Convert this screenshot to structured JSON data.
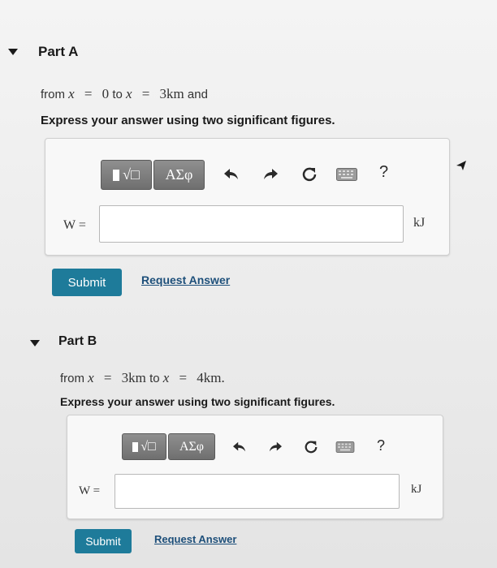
{
  "partA": {
    "title": "Part A",
    "line": {
      "from": "from",
      "x1": "x",
      "eq1": "=",
      "v1": "0",
      "to": "to",
      "x2": "x",
      "eq2": "=",
      "v2": "3km",
      "tail": "and"
    },
    "instruction": "Express your answer using two significant figures.",
    "toolbar": {
      "templates_label": "√□",
      "greek_label": "ΑΣφ",
      "help_label": "?"
    },
    "input_label": "W =",
    "input_value": "",
    "unit": "kJ",
    "submit_label": "Submit",
    "request_label": "Request Answer"
  },
  "partB": {
    "title": "Part B",
    "line": {
      "from": "from",
      "x1": "x",
      "eq1": "=",
      "v1": "3km",
      "to": "to",
      "x2": "x",
      "eq2": "=",
      "v2": "4km."
    },
    "instruction": "Express your answer using two significant figures.",
    "toolbar": {
      "templates_label": "√□",
      "greek_label": "ΑΣφ",
      "help_label": "?"
    },
    "input_label": "W =",
    "input_value": "",
    "unit": "kJ",
    "submit_label": "Submit",
    "request_label": "Request Answer"
  },
  "icons": {
    "undo": "undo-icon",
    "redo": "redo-icon",
    "reset": "reset-icon",
    "keyboard": "keyboard-icon",
    "collapse": "caret-down-icon",
    "cursor": "mouse-cursor-icon"
  },
  "colors": {
    "submit": "#1e7b9a",
    "link": "#1d4f7a",
    "toolbar_button": "#7f7f7f"
  }
}
